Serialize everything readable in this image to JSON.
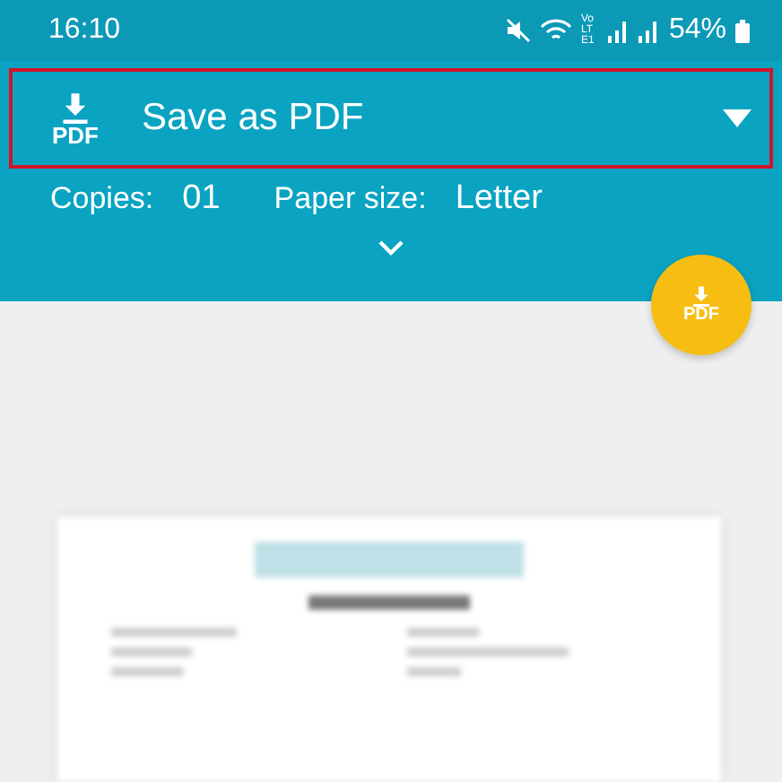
{
  "status_bar": {
    "time": "16:10",
    "network_label": "Vo LTE1",
    "battery": "54%"
  },
  "printer": {
    "icon_label": "PDF",
    "name": "Save as PDF",
    "highlighted": true
  },
  "options": [
    {
      "label": "Copies:",
      "value": "01"
    },
    {
      "label": "Paper size:",
      "value": "Letter"
    }
  ],
  "fab": {
    "label": "PDF"
  }
}
